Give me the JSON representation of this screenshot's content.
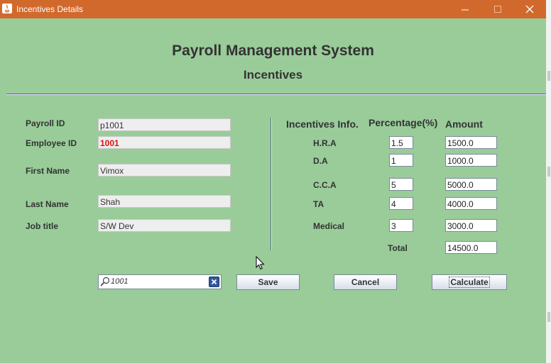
{
  "window": {
    "title": "Incentives Details"
  },
  "header": {
    "title": "Payroll Management System",
    "subtitle": "Incentives"
  },
  "employee": {
    "payroll_id_label": "Payroll  ID",
    "payroll_id": "p1001",
    "employee_id_label": "Employee ID",
    "employee_id": "1001",
    "first_name_label": "First Name",
    "first_name": "Vimox",
    "last_name_label": "Last Name",
    "last_name": "Shah",
    "job_title_label": "Job title",
    "job_title": "S/W Dev"
  },
  "incentives": {
    "header_info": "Incentives Info.",
    "header_percentage": "Percentage(%)",
    "header_amount": "Amount",
    "rows": [
      {
        "label": "H.R.A",
        "percentage": "1.5",
        "amount": "1500.0"
      },
      {
        "label": "D.A",
        "percentage": "1",
        "amount": "1000.0"
      },
      {
        "label": "C.C.A",
        "percentage": "5",
        "amount": "5000.0"
      },
      {
        "label": "TA",
        "percentage": "4",
        "amount": "4000.0"
      },
      {
        "label": "Medical",
        "percentage": "3",
        "amount": "3000.0"
      }
    ],
    "total_label": "Total",
    "total": "14500.0"
  },
  "search": {
    "value": "1001"
  },
  "buttons": {
    "save": "Save",
    "cancel": "Cancel",
    "calculate": "Calculate"
  },
  "colors": {
    "background": "#99cc99",
    "titlebar": "#d2692c",
    "employee_id_text": "#e01010"
  }
}
